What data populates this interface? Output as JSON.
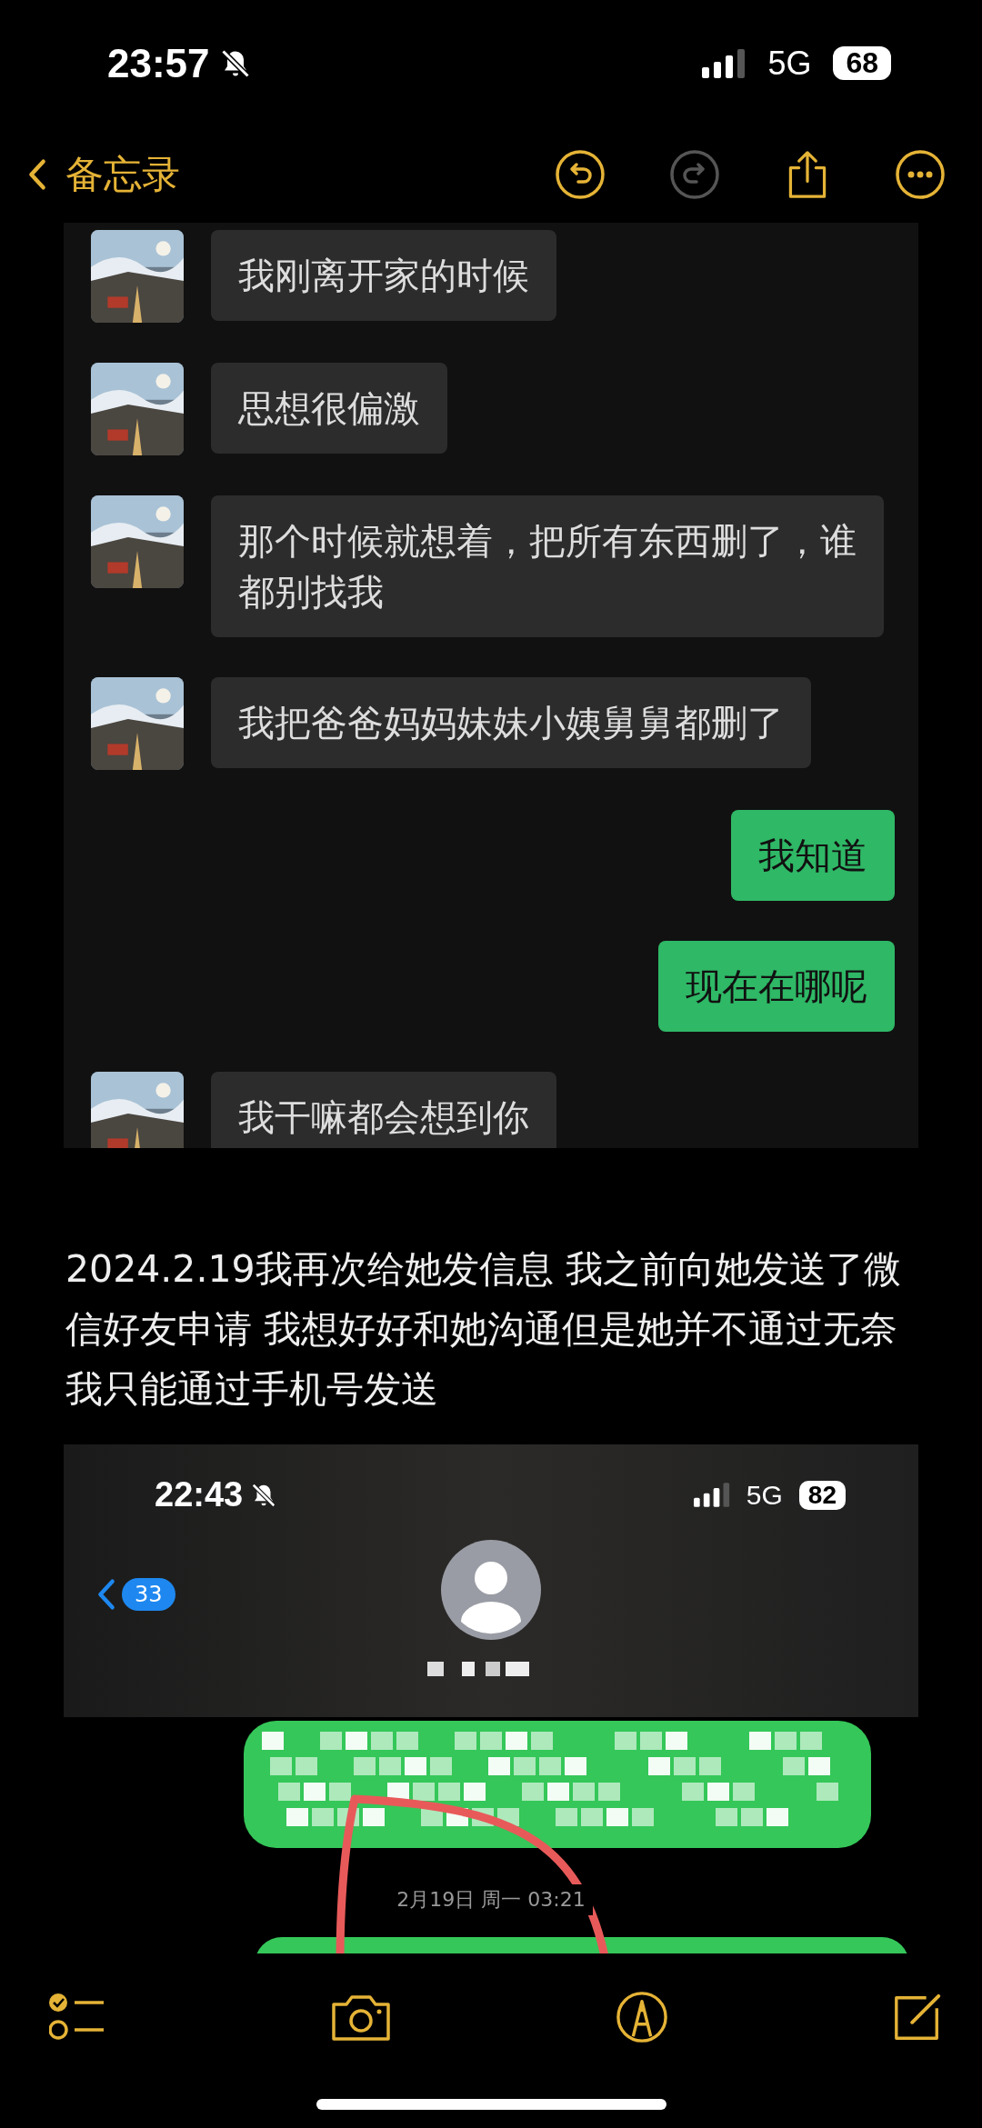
{
  "status_bar": {
    "time": "23:57",
    "network": "5G",
    "battery": "68"
  },
  "nav": {
    "back_label": "备忘录"
  },
  "chat_screenshot": {
    "messages": [
      {
        "kind": "received",
        "text": "我刚离开家的时候"
      },
      {
        "kind": "received",
        "text": "思想很偏激"
      },
      {
        "kind": "received",
        "text": "那个时候就想着，把所有东西删了，谁都别找我"
      },
      {
        "kind": "received",
        "text": "我把爸爸妈妈妹妹小姨舅舅都删了"
      },
      {
        "kind": "sent",
        "text": "我知道"
      },
      {
        "kind": "sent",
        "text": "现在在哪呢"
      },
      {
        "kind": "received",
        "text": "我干嘛都会想到你"
      }
    ]
  },
  "note_text": "2024.2.19我再次给她发信息 我之前向她发送了微信好友申请 我想好好和她沟通但是她并不通过无奈我只能通过手机号发送",
  "sms_screenshot": {
    "status_bar": {
      "time": "22:43",
      "network": "5G",
      "battery": "82"
    },
    "back_badge": "33",
    "timestamp": "2月19日 周一 03:21"
  }
}
